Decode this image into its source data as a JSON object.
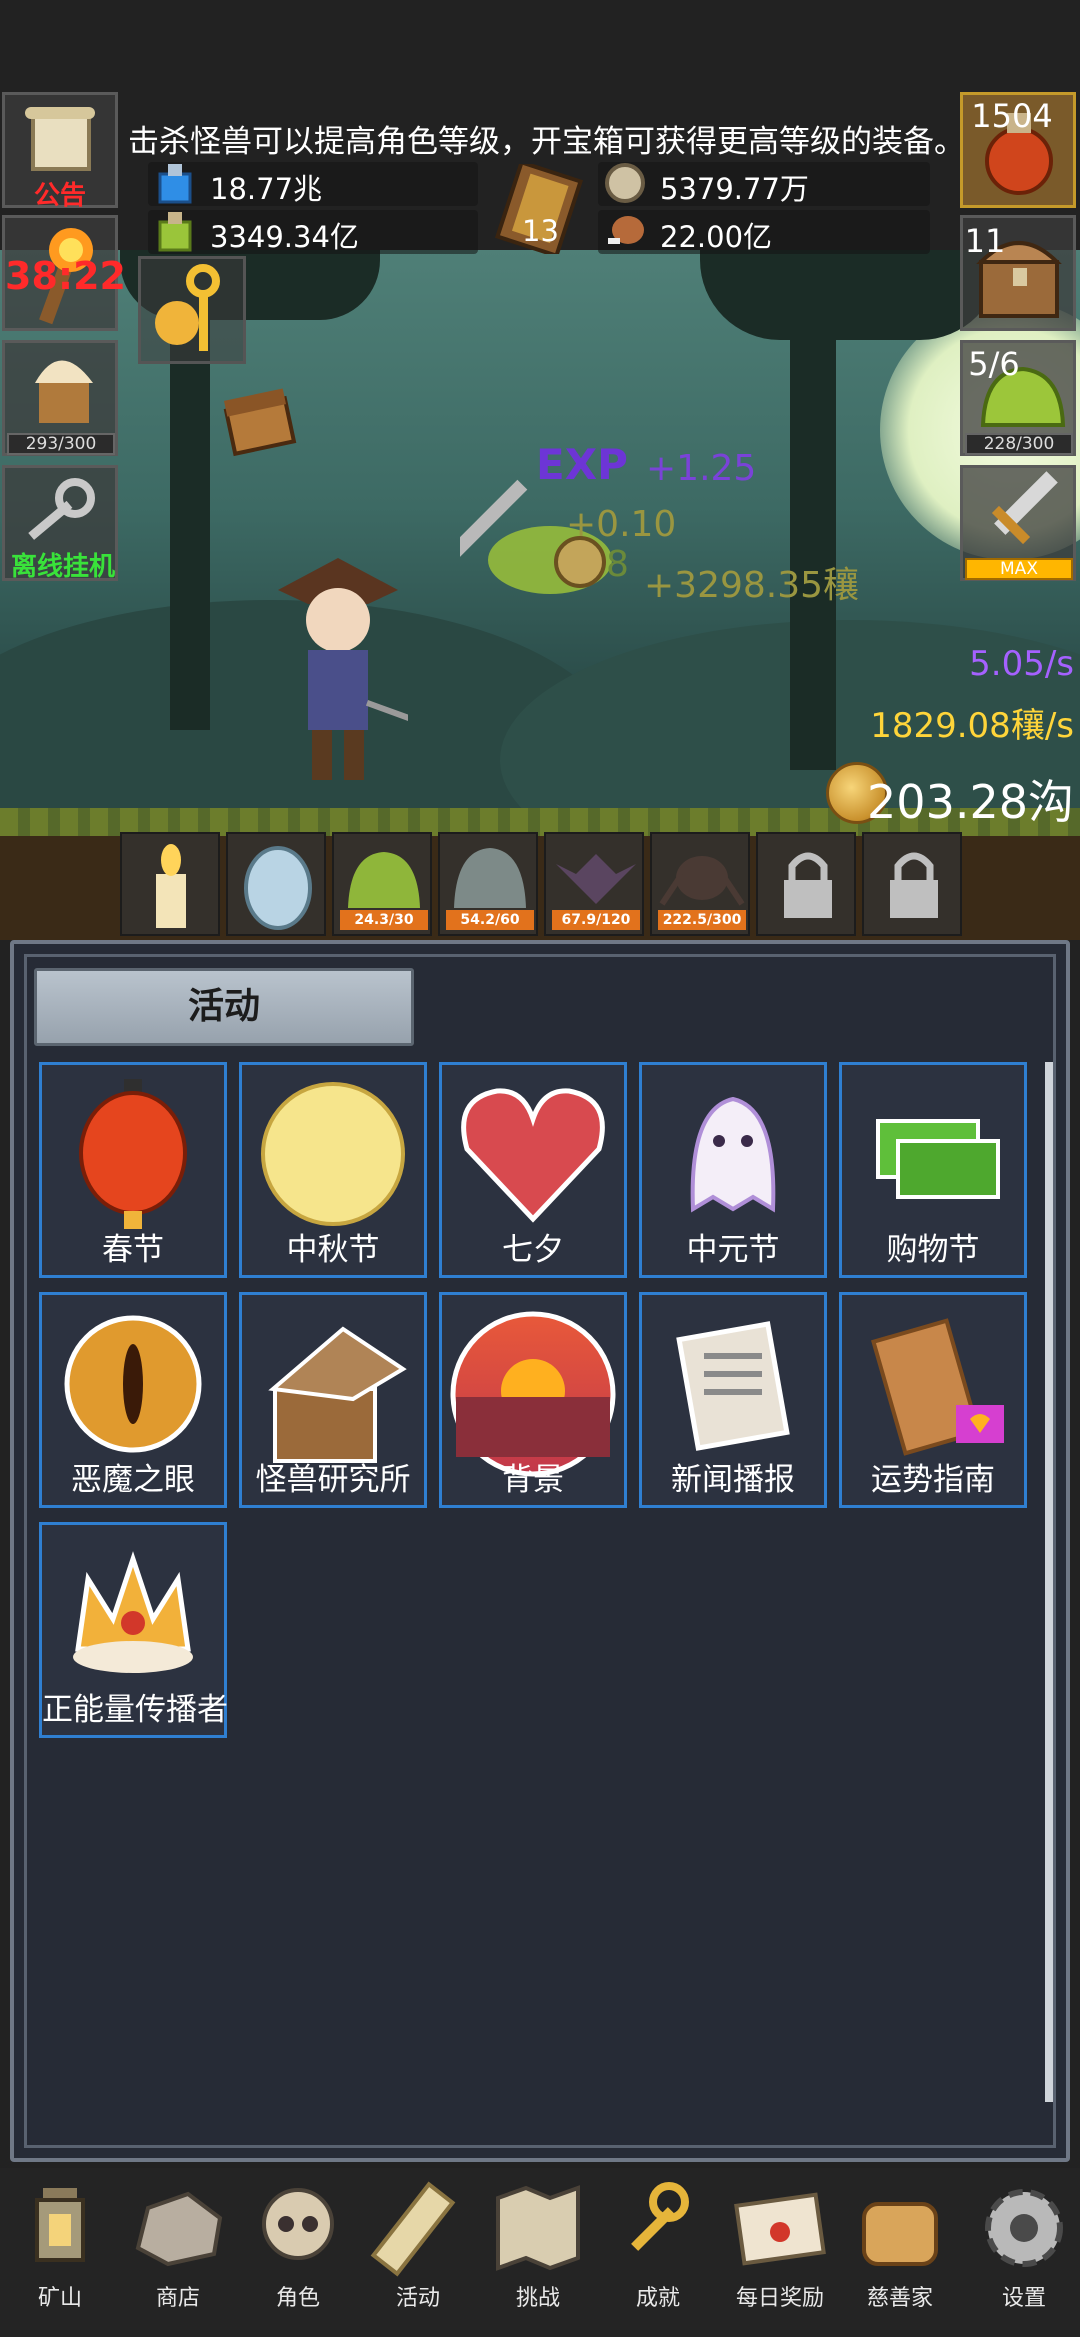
{
  "hud": {
    "notice": "击杀怪兽可以提高角色等级，开宝箱可获得更高等级的装备。",
    "announce_label": "公告",
    "timer": "38:22",
    "food_count": "293/300",
    "offline_label": "离线挂机",
    "potion_count": "1504",
    "chest_count": "11",
    "slime_count": "5/6",
    "slime_bar": "228/300",
    "sword_bar": "MAX",
    "book_count": "13"
  },
  "resources": {
    "blue_potion": "18.77兆",
    "green_potion": "3349.34亿",
    "silver_coin": "5379.77万",
    "meat": "22.00亿"
  },
  "floating": {
    "exp_tag": "EXP",
    "exp_gain": "+1.25",
    "small_gain": "+0.10",
    "digit": "8",
    "coin_gain": "+3298.35穰"
  },
  "rates": {
    "exp_rate": "5.05/s",
    "coin_rate": "1829.08穰/s",
    "coin_total": "203.28沟"
  },
  "monsters": [
    {
      "name": "candle",
      "badge": ""
    },
    {
      "name": "egg",
      "badge": ""
    },
    {
      "name": "slime",
      "badge": "24.3/30"
    },
    {
      "name": "ghost",
      "badge": "54.2/60"
    },
    {
      "name": "bat",
      "badge": "67.9/120"
    },
    {
      "name": "spider",
      "badge": "222.5/300"
    },
    {
      "name": "locked-1",
      "badge": ""
    },
    {
      "name": "locked-2",
      "badge": ""
    }
  ],
  "panel": {
    "tab_label": "活动",
    "tiles": [
      {
        "label": "春节",
        "icon": "lantern-icon"
      },
      {
        "label": "中秋节",
        "icon": "moon-icon"
      },
      {
        "label": "七夕",
        "icon": "heart-icon"
      },
      {
        "label": "中元节",
        "icon": "ghost-icon"
      },
      {
        "label": "购物节",
        "icon": "money-icon"
      },
      {
        "label": "恶魔之眼",
        "icon": "eye-icon"
      },
      {
        "label": "怪兽研究所",
        "icon": "lab-icon"
      },
      {
        "label": "背景",
        "icon": "sunset-icon"
      },
      {
        "label": "新闻播报",
        "icon": "news-icon"
      },
      {
        "label": "运势指南",
        "icon": "fortune-icon"
      },
      {
        "label": "正能量传播者",
        "icon": "crown-icon"
      }
    ]
  },
  "nav": [
    {
      "label": "矿山",
      "icon": "lantern-nav-icon"
    },
    {
      "label": "商店",
      "icon": "stone-nav-icon"
    },
    {
      "label": "角色",
      "icon": "skull-nav-icon"
    },
    {
      "label": "活动",
      "icon": "scroll-nav-icon"
    },
    {
      "label": "挑战",
      "icon": "map-nav-icon"
    },
    {
      "label": "成就",
      "icon": "key-nav-icon"
    },
    {
      "label": "每日奖励",
      "icon": "letter-nav-icon"
    },
    {
      "label": "慈善家",
      "icon": "bread-nav-icon"
    },
    {
      "label": "设置",
      "icon": "gear-nav-icon"
    }
  ],
  "colors": {
    "tile_border": "#2f7fd1",
    "panel_bg": "#262b36",
    "exp_purple": "#a561ff",
    "coin_gold": "#ffd53a",
    "timer_red": "#ff2a2a",
    "offline_green": "#39e23a"
  }
}
